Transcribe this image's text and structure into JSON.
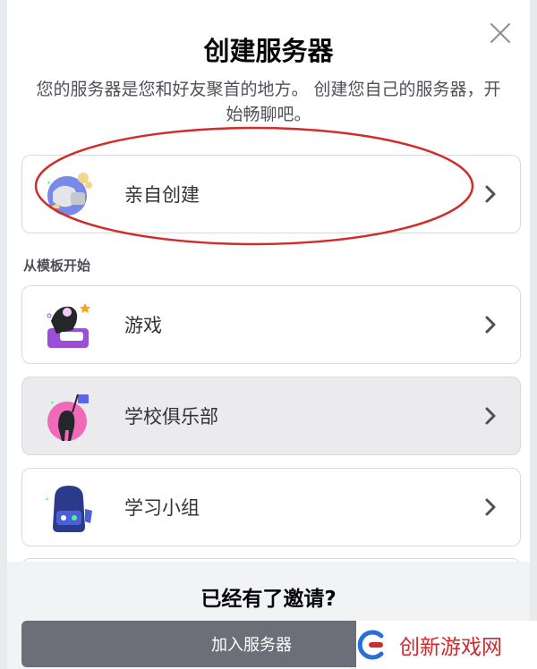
{
  "modal": {
    "title": "创建服务器",
    "subtitle": "您的服务器是您和好友聚首的地方。 创建您自己的服务器，开始畅聊吧。"
  },
  "create_own": {
    "label": "亲自创建",
    "icon": "globe-create-icon"
  },
  "section_label": "从模板开始",
  "templates": [
    {
      "label": "游戏",
      "icon": "gaming-icon"
    },
    {
      "label": "学校俱乐部",
      "icon": "school-club-icon"
    },
    {
      "label": "学习小组",
      "icon": "backpack-icon"
    }
  ],
  "footer": {
    "title": "已经有了邀请?",
    "join_label": "加入服务器"
  },
  "watermark": {
    "text": "创新游戏网"
  },
  "colors": {
    "annotation": "#d32a2a",
    "button": "#6d6f78",
    "text": "#313338"
  }
}
